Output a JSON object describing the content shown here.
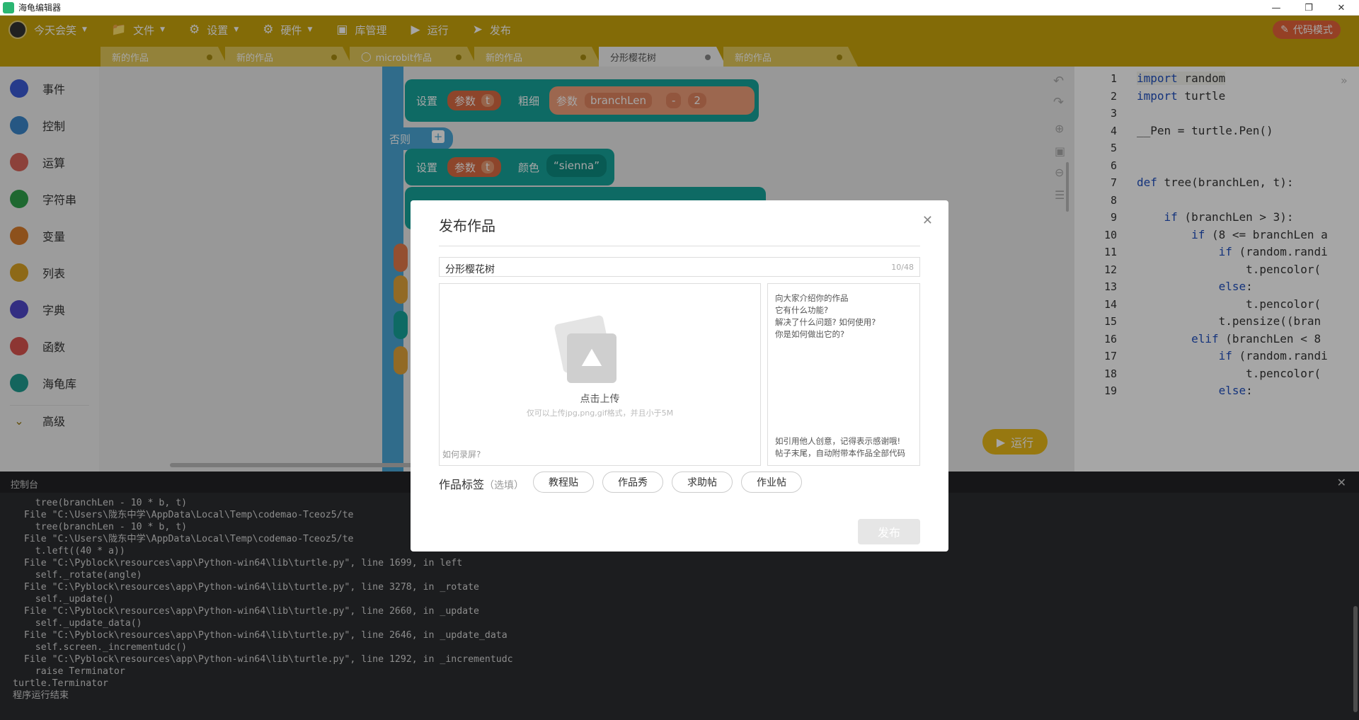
{
  "window": {
    "title": "海龟编辑器"
  },
  "toolbar": {
    "user": "今天会笑",
    "file": "文件",
    "settings": "设置",
    "hardware": "硬件",
    "library": "库管理",
    "run": "运行",
    "publish": "发布",
    "code_mode": "代码模式"
  },
  "tabs": [
    {
      "label": "新的作品"
    },
    {
      "label": "新的作品"
    },
    {
      "label": "microbit作品"
    },
    {
      "label": "新的作品"
    },
    {
      "label": "分形樱花树"
    },
    {
      "label": "新的作品"
    }
  ],
  "categories": [
    {
      "label": "事件",
      "color": "#3b5bd6"
    },
    {
      "label": "控制",
      "color": "#3b86c9"
    },
    {
      "label": "运算",
      "color": "#d8655a"
    },
    {
      "label": "字符串",
      "color": "#2ea04a"
    },
    {
      "label": "变量",
      "color": "#d97d2b"
    },
    {
      "label": "列表",
      "color": "#d9a224"
    },
    {
      "label": "字典",
      "color": "#4f47c8"
    },
    {
      "label": "函数",
      "color": "#d9534f"
    },
    {
      "label": "海龟库",
      "color": "#1f9b8f"
    },
    {
      "label": "高级",
      "color": "#9a7a10"
    }
  ],
  "blocks": {
    "set1": "设置",
    "param": "参数",
    "t": "t",
    "thickness": "粗细",
    "param2": "参数",
    "branchLen": "branchLen",
    "minus": "-",
    "two": "2",
    "else": "否则",
    "set2": "设置",
    "param3": "参数",
    "t2": "t",
    "color": "颜色",
    "sienna": "“sienna”"
  },
  "run_button": "运行",
  "code": {
    "lines": [
      "1",
      "2",
      "3",
      "4",
      "5",
      "6",
      "7",
      "8",
      "9",
      "10",
      "11",
      "12",
      "13",
      "14",
      "15",
      "16",
      "17",
      "18",
      "19"
    ],
    "text": [
      "import random",
      "import turtle",
      "",
      "__Pen = turtle.Pen()",
      "",
      "",
      "def tree(branchLen, t):",
      "",
      "    if (branchLen > 3):",
      "        if (8 <= branchLen a",
      "            if (random.randi",
      "                t.pencolor(",
      "            else:",
      "                t.pencolor(",
      "            t.pensize((bran",
      "        elif (branchLen < 8",
      "            if (random.randi",
      "                t.pencolor(",
      "            else:"
    ]
  },
  "console": {
    "title": "控制台",
    "output": "    tree(branchLen - 10 * b, t)\n  File \"C:\\Users\\陇东中学\\AppData\\Local\\Temp\\codemao-Tceoz5/te\n    tree(branchLen - 10 * b, t)\n  File \"C:\\Users\\陇东中学\\AppData\\Local\\Temp\\codemao-Tceoz5/te\n    t.left((40 * a))\n  File \"C:\\Pyblock\\resources\\app\\Python-win64\\lib\\turtle.py\", line 1699, in left\n    self._rotate(angle)\n  File \"C:\\Pyblock\\resources\\app\\Python-win64\\lib\\turtle.py\", line 3278, in _rotate\n    self._update()\n  File \"C:\\Pyblock\\resources\\app\\Python-win64\\lib\\turtle.py\", line 2660, in _update\n    self._update_data()\n  File \"C:\\Pyblock\\resources\\app\\Python-win64\\lib\\turtle.py\", line 2646, in _update_data\n    self.screen._incrementudc()\n  File \"C:\\Pyblock\\resources\\app\\Python-win64\\lib\\turtle.py\", line 1292, in _incrementudc\n    raise Terminator\nturtle.Terminator\n程序运行结束"
  },
  "modal": {
    "title": "发布作品",
    "name_value": "分形樱花树",
    "name_count": "10/48",
    "upload_label": "点击上传",
    "upload_hint": "仅可以上传jpg,png,gif格式，并且小于5M",
    "record_hint": "如何录屏?",
    "desc_placeholder": [
      "向大家介绍你的作品",
      "它有什么功能?",
      "解决了什么问题? 如何使用?",
      "你是如何做出它的?"
    ],
    "desc_footer": [
      "如引用他人创意，记得表示感谢哦!",
      "帖子末尾，自动附带本作品全部代码"
    ],
    "tags_label": "作品标签",
    "tags_optional": "（选填）",
    "tags": [
      "教程贴",
      "作品秀",
      "求助帖",
      "作业帖"
    ],
    "publish": "发布"
  }
}
